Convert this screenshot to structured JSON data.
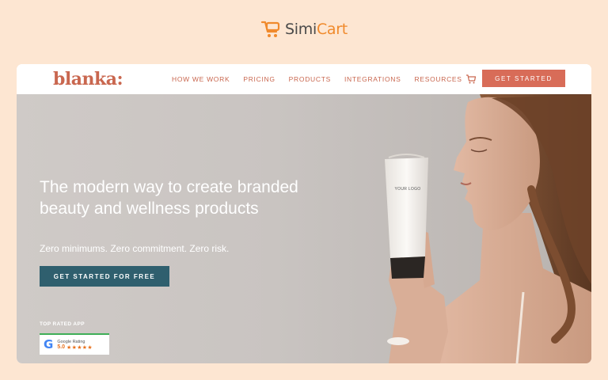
{
  "simicart": {
    "simi": "Simi",
    "cart": "Cart",
    "icon": "simicart-logo-icon"
  },
  "nav": {
    "brand": "blanka",
    "brand_dot": ":",
    "links": [
      "HOW WE WORK",
      "PRICING",
      "PRODUCTS",
      "INTEGRATIONS",
      "RESOURCES"
    ],
    "cart_icon": "cart-icon",
    "cta": "GET STARTED"
  },
  "hero": {
    "title": "The modern way to create branded beauty and wellness products",
    "subtitle": "Zero minimums. Zero commitment. Zero risk.",
    "cta": "GET STARTED FOR FREE",
    "top_rated": "TOP RATED APP",
    "badge": {
      "title": "Google Rating",
      "score": "5.0",
      "stars": "★★★★★",
      "rating": 5
    },
    "tube_label": "YOUR LOGO"
  },
  "colors": {
    "page_bg": "#fde6d2",
    "brand": "#c9674f",
    "nav_cta": "#d86c58",
    "hero_cta": "#2f5f6e",
    "simicart_orange": "#f08a2c"
  }
}
